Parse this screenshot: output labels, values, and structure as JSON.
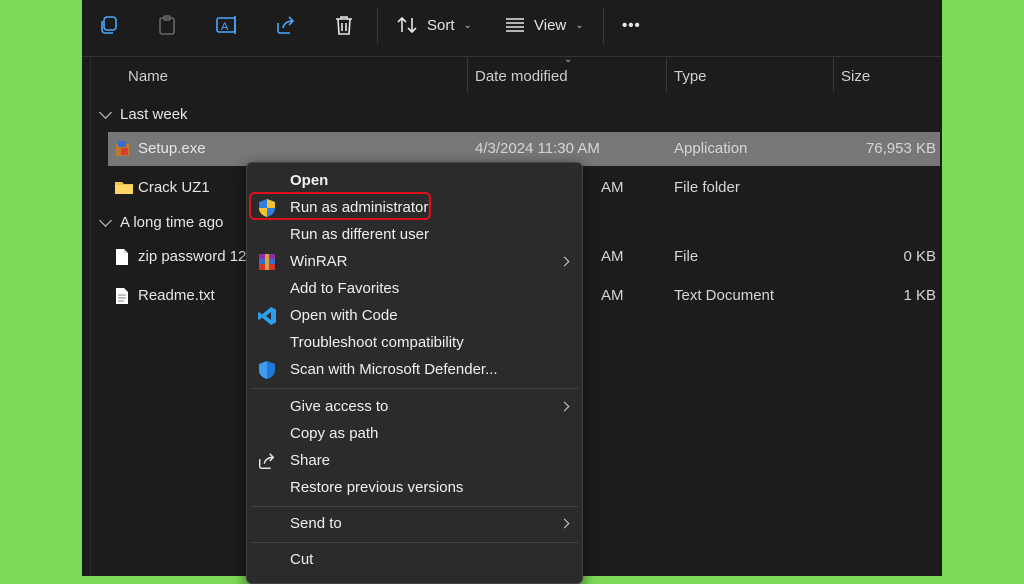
{
  "toolbar": {
    "sort_label": "Sort",
    "view_label": "View",
    "more_label": "•••"
  },
  "columns": {
    "name": "Name",
    "date_modified": "Date modified",
    "type": "Type",
    "size": "Size"
  },
  "groups": {
    "last_week": "Last week",
    "long_time_ago": "A long time ago"
  },
  "files": [
    {
      "name": "Setup.exe",
      "date": "4/3/2024 11:30 AM",
      "type": "Application",
      "size": "76,953 KB",
      "icon": "installer-icon"
    },
    {
      "name": "Crack UZ1",
      "date": "AM",
      "type": "File folder",
      "size": "",
      "icon": "folder-icon"
    },
    {
      "name": "zip password 12",
      "date": "AM",
      "type": "File",
      "size": "0 KB",
      "icon": "file-icon"
    },
    {
      "name": "Readme.txt",
      "date": "AM",
      "type": "Text Document",
      "size": "1 KB",
      "icon": "text-file-icon"
    }
  ],
  "context_menu": {
    "items": [
      {
        "label": "Open",
        "icon": ""
      },
      {
        "label": "Run as administrator",
        "icon": "uac-shield-icon"
      },
      {
        "label": "Run as different user",
        "icon": ""
      },
      {
        "label": "WinRAR",
        "icon": "winrar-icon"
      },
      {
        "label": "Add to Favorites",
        "icon": ""
      },
      {
        "label": "Open with Code",
        "icon": "vscode-icon"
      },
      {
        "label": "Troubleshoot compatibility",
        "icon": ""
      },
      {
        "label": "Scan with Microsoft Defender...",
        "icon": "defender-shield-icon"
      },
      {
        "label": "Give access to",
        "icon": ""
      },
      {
        "label": "Copy as path",
        "icon": ""
      },
      {
        "label": "Share",
        "icon": "share-icon"
      },
      {
        "label": "Restore previous versions",
        "icon": ""
      },
      {
        "label": "Send to",
        "icon": ""
      },
      {
        "label": "Cut",
        "icon": ""
      }
    ]
  },
  "colors": {
    "background": "#7ed957",
    "window": "#1c1c1c",
    "menu": "#2b2b2b",
    "selection": "#777777",
    "highlight_border": "#e0101a"
  }
}
